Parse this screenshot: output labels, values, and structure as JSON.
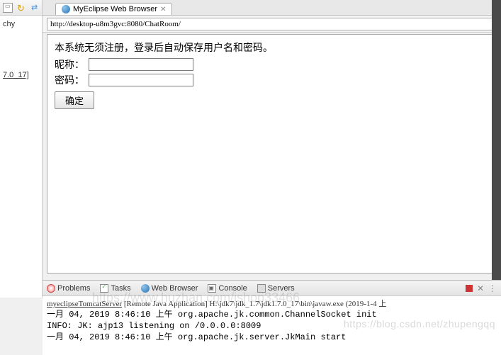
{
  "left": {
    "truncated_title": "chy",
    "jdk_label": "7.0_17]"
  },
  "tab": {
    "truncated": "",
    "title": "MyEclipse Web Browser"
  },
  "addr": {
    "url": "http://desktop-u8m3gvc:8080/ChatRoom/"
  },
  "page": {
    "message": "本系统无须注册，登录后自动保存用户名和密码。",
    "nickname_label": "昵称：",
    "password_label": "密码：",
    "submit_label": "确定"
  },
  "bottom_tabs": {
    "problems": "Problems",
    "tasks": "Tasks",
    "web": "Web Browser",
    "console": "Console",
    "servers": "Servers"
  },
  "console": {
    "header_pre": "myeclipseTomcatServer",
    "header_mid": " [Remote Java Application] H:\\jdk7\\jdk_1.7\\jdk1.7.0_17\\bin\\javaw.exe (2019-1-4 上",
    "line1": "一月 04, 2019 8:46:10 上午 org.apache.jk.common.ChannelSocket init",
    "line2": "INFO: JK: ajp13 listening on /0.0.0.0:8009",
    "line3": "一月 04, 2019 8:46:10 上午 org.apache.jk.server.JkMain start"
  },
  "watermarks": {
    "w1": "https://blog.csdn.net/zhupengqq",
    "w2": "https://www.huzhan.com/ishop33466"
  }
}
